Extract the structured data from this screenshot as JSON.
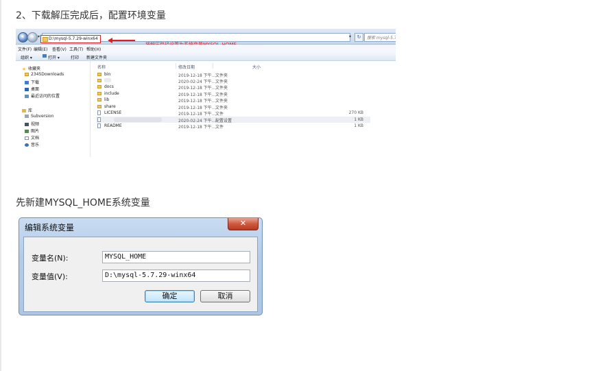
{
  "step2_heading": "2、下载解压完成后，配置环境变量",
  "explorer": {
    "address_path": "D:\\mysql-5.7.29-winx64",
    "annotation": "将解压路径设置为系统变量MYSQL_HOME",
    "search_placeholder": "搜索 mysql-5.7.2",
    "menu": [
      "文件(F)",
      "编辑(E)",
      "查看(V)",
      "工具(T)",
      "帮助(H)"
    ],
    "toolbar": {
      "organize": "组织 ▾",
      "open": "打开 ▾",
      "print": "打印",
      "new_folder": "新建文件夹"
    },
    "nav": {
      "favorites": "收藏夹",
      "downloads_2345": "2345Downloads",
      "downloads": "下载",
      "desktop": "桌面",
      "recent": "最近访问的位置",
      "libraries": "库",
      "subversion": "Subversion",
      "videos": "视频",
      "pictures": "图片",
      "documents": "文档",
      "music": "音乐"
    },
    "columns": {
      "name": "名称",
      "date": "修改日期",
      "type": "类型",
      "size": "大小"
    },
    "files": [
      {
        "name": "bin",
        "date": "2019-12-18 下午...",
        "type": "文件夹",
        "size": ""
      },
      {
        "name": "",
        "date": "2020-02-24 下午...",
        "type": "文件夹",
        "size": ""
      },
      {
        "name": "docs",
        "date": "2019-12-18 下午...",
        "type": "文件夹",
        "size": ""
      },
      {
        "name": "include",
        "date": "2019-12-18 下午...",
        "type": "文件夹",
        "size": ""
      },
      {
        "name": "lib",
        "date": "2019-12-18 下午...",
        "type": "文件夹",
        "size": ""
      },
      {
        "name": "share",
        "date": "2019-12-18 下午...",
        "type": "文件夹",
        "size": ""
      },
      {
        "name": "LICENSE",
        "date": "2019-12-18 下午...",
        "type": "文件",
        "size": "270 KB"
      },
      {
        "name": "",
        "date": "2020-02-24 下午...",
        "type": "配置设置",
        "size": "1 KB"
      },
      {
        "name": "README",
        "date": "2019-12-18 下午...",
        "type": "文件",
        "size": "1 KB"
      }
    ]
  },
  "new_var_heading": "先新建MYSQL_HOME系统变量",
  "dialog": {
    "title": "编辑系统变量",
    "close_symbol": "✕",
    "var_name_label": "变量名(N):",
    "var_name_value": "MYSQL_HOME",
    "var_value_label": "变量值(V):",
    "var_value_value": "D:\\mysql-5.7.29-winx64",
    "ok_label": "确定",
    "cancel_label": "取消"
  }
}
